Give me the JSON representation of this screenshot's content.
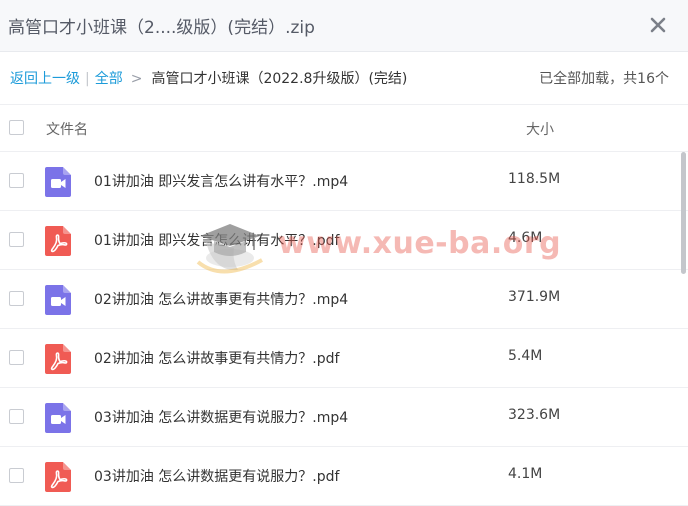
{
  "dialog": {
    "title": "高管口才小班课（2....级版）(完结）.zip",
    "close_icon": "close-icon"
  },
  "breadcrumb": {
    "back": "返回上一级",
    "separator": "|",
    "all": "全部",
    "arrow": ">",
    "current": "高管口才小班课（2022.8升级版）(完结)"
  },
  "status": "已全部加载，共16个",
  "table": {
    "columns": {
      "name": "文件名",
      "size": "大小"
    },
    "rows": [
      {
        "type": "video",
        "icon": "video-file-icon",
        "name": "01讲加油 即兴发言怎么讲有水平？.mp4",
        "size": "118.5M"
      },
      {
        "type": "pdf",
        "icon": "pdf-file-icon",
        "name": "01讲加油 即兴发言怎么讲有水平？.pdf",
        "size": "4.6M"
      },
      {
        "type": "video",
        "icon": "video-file-icon",
        "name": "02讲加油 怎么讲故事更有共情力？.mp4",
        "size": "371.9M"
      },
      {
        "type": "pdf",
        "icon": "pdf-file-icon",
        "name": "02讲加油 怎么讲故事更有共情力？.pdf",
        "size": "5.4M"
      },
      {
        "type": "video",
        "icon": "video-file-icon",
        "name": "03讲加油 怎么讲数据更有说服力？.mp4",
        "size": "323.6M"
      },
      {
        "type": "pdf",
        "icon": "pdf-file-icon",
        "name": "03讲加油 怎么讲数据更有说服力？.pdf",
        "size": "4.1M"
      }
    ]
  },
  "watermark": "www.xue-ba.org",
  "colors": {
    "link": "#1c9bd9",
    "video_icon": "#7b73e8",
    "pdf_icon": "#f05b54",
    "watermark": "#e85a4f"
  }
}
